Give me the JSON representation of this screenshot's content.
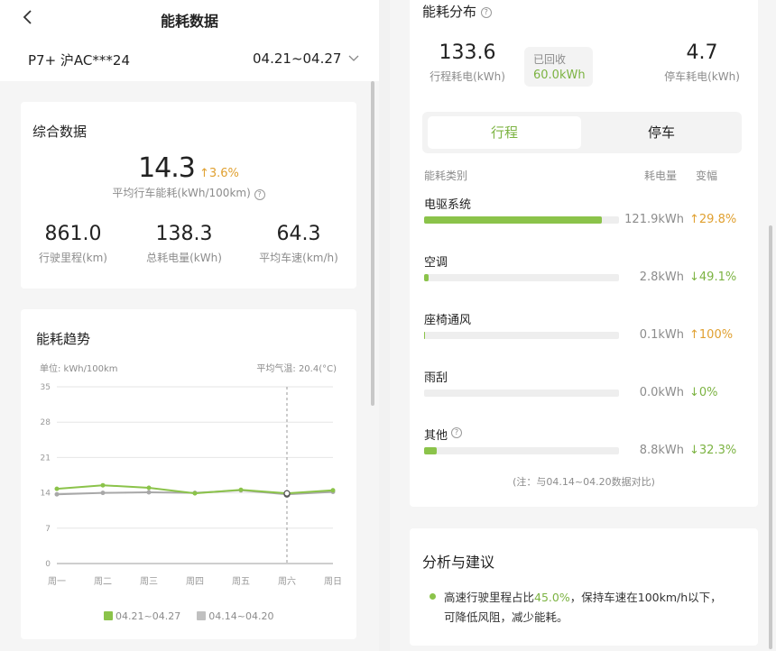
{
  "header": {
    "title": "能耗数据",
    "vehicle": "P7+ 沪AC***24",
    "date_range": "04.21~04.27"
  },
  "summary": {
    "title": "综合数据",
    "avg": {
      "value": "14.3",
      "change": "3.6%",
      "label": "平均行车能耗(kWh/100km)"
    },
    "stats": [
      {
        "value": "861.0",
        "label": "行驶里程(km)"
      },
      {
        "value": "138.3",
        "label": "总耗电量(kWh)"
      },
      {
        "value": "64.3",
        "label": "平均车速(km/h)"
      }
    ]
  },
  "trend": {
    "title": "能耗趋势",
    "unit": "单位: kWh/100km",
    "temp": "平均气温: 20.4(°C)",
    "legend": [
      "04.21~04.27",
      "04.14~04.20"
    ]
  },
  "chart_data": {
    "type": "line",
    "categories": [
      "周一",
      "周二",
      "周三",
      "周四",
      "周五",
      "周六",
      "周日"
    ],
    "ylim": [
      0,
      35
    ],
    "yticks": [
      "0",
      "7",
      "14",
      "21",
      "28",
      "35"
    ],
    "series": [
      {
        "name": "04.21~04.27",
        "values": [
          14.8,
          15.5,
          15.0,
          13.9,
          14.6,
          13.9,
          14.5
        ],
        "color": "#8bc34a"
      },
      {
        "name": "04.14~04.20",
        "values": [
          13.7,
          14.0,
          14.1,
          14.0,
          14.5,
          13.7,
          14.2
        ],
        "color": "#a8a8a8"
      }
    ],
    "highlight_index": 5,
    "grid": true,
    "legend_position": "bottom"
  },
  "distribution": {
    "title": "能耗分布",
    "trip": {
      "value": "133.6",
      "label": "行程耗电(kWh)"
    },
    "recovered": {
      "label": "已回收",
      "value": "60.0kWh"
    },
    "parking": {
      "value": "4.7",
      "label": "停车耗电(kWh)"
    },
    "tabs": [
      "行程",
      "停车"
    ],
    "columns": {
      "category": "能耗类别",
      "energy": "耗电量",
      "change": "变幅"
    },
    "items": [
      {
        "name": "电驱系统",
        "energy": "121.9kWh",
        "change": "29.8%",
        "direction": "up",
        "fill": 0.91
      },
      {
        "name": "空调",
        "energy": "2.8kWh",
        "change": "49.1%",
        "direction": "down",
        "fill": 0.025
      },
      {
        "name": "座椅通风",
        "energy": "0.1kWh",
        "change": "100%",
        "direction": "up",
        "fill": 0.005
      },
      {
        "name": "雨刮",
        "energy": "0.0kWh",
        "change": "0%",
        "direction": "down",
        "fill": 0
      },
      {
        "name": "其他",
        "energy": "8.8kWh",
        "change": "32.3%",
        "direction": "down",
        "fill": 0.066
      }
    ],
    "note": "(注：与04.14~04.20数据对比)"
  },
  "advice": {
    "title": "分析与建议",
    "prefix": "高速行驶里程占比",
    "highlight": "45.0%",
    "suffix": "，保持车速在100km/h以下，",
    "line2": "可降低风阻，减少能耗。"
  },
  "colors": {
    "accent": "#8bc34a",
    "up": "#e0a030",
    "down": "#7cb342"
  }
}
